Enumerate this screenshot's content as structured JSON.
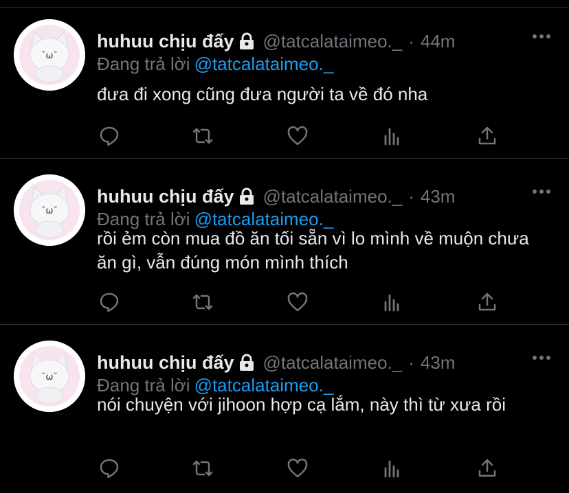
{
  "tweets": [
    {
      "name": "huhuu chịu đấy",
      "handle": "@tatcalataimeo._",
      "dot": "·",
      "time": "44m",
      "reply_prefix": "Đang trả lời",
      "reply_to": "@tatcalataimeo._",
      "text": "đưa đi xong cũng đưa người ta về đó nha"
    },
    {
      "name": "huhuu chịu đấy",
      "handle": "@tatcalataimeo._",
      "dot": "·",
      "time": "43m",
      "reply_prefix": "Đang trả lời",
      "reply_to": "@tatcalataimeo._",
      "text": "rồi ẻm còn mua đồ ăn tối sẵn vì lo mình về muộn chưa ăn gì, vẫn đúng món mình thích"
    },
    {
      "name": "huhuu chịu đấy",
      "handle": "@tatcalataimeo._",
      "dot": "·",
      "time": "43m",
      "reply_prefix": "Đang trả lời",
      "reply_to": "@tatcalataimeo._",
      "text": "nói chuyện với jihoon hợp cạ lắm, này thì từ xưa rồi"
    }
  ],
  "icons": {
    "reply": "reply-icon",
    "retweet": "retweet-icon",
    "like": "heart-icon",
    "analytics": "analytics-icon",
    "share": "share-icon",
    "more": "more-icon",
    "lock": "lock-icon"
  },
  "colors": {
    "background": "#000000",
    "text": "#e7e9ea",
    "muted": "#71767b",
    "link": "#1d9bf0",
    "separator": "#2f3336"
  }
}
